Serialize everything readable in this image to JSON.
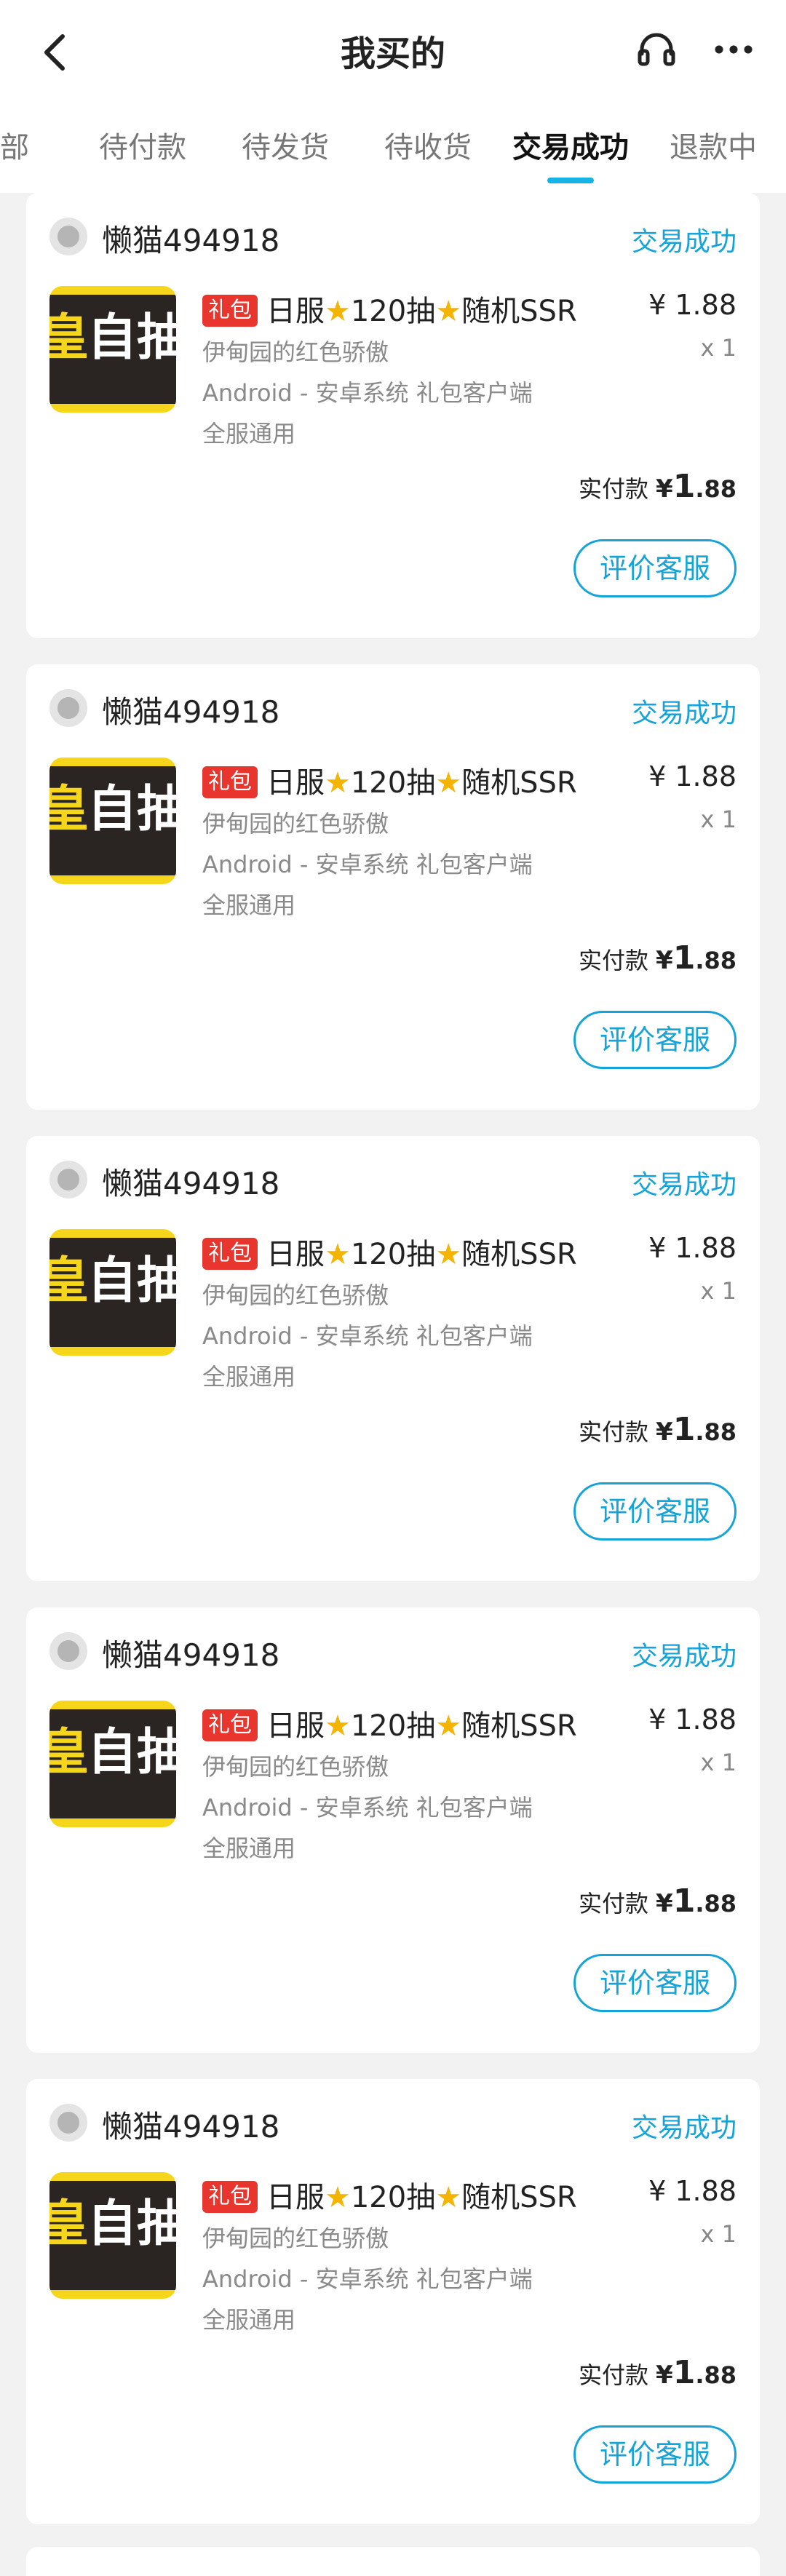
{
  "header": {
    "title": "我买的",
    "back_icon": "chevron-left-icon",
    "service_icon": "headset-icon",
    "more_icon": "more-dots-icon"
  },
  "tabs": [
    {
      "label": "部",
      "active": false
    },
    {
      "label": "待付款",
      "active": false
    },
    {
      "label": "待发货",
      "active": false
    },
    {
      "label": "待收货",
      "active": false
    },
    {
      "label": "交易成功",
      "active": true
    },
    {
      "label": "退款中",
      "active": false
    }
  ],
  "colors": {
    "accent": "#15b3e6",
    "tag_red": "#e8352e",
    "thumb_yellow": "#f6d61a",
    "thumb_dark": "#2a2523"
  },
  "orders": [
    {
      "shop": "懒猫494918",
      "status": "交易成功",
      "thumb_text_left": "皇",
      "thumb_text_right": "自抽",
      "tag": "礼包",
      "title_part1": "日服",
      "title_part2": "120抽",
      "title_part3": "随机SSR",
      "price": "¥ 1.88",
      "qty": "x 1",
      "line1": "伊甸园的红色骄傲",
      "line2": "Android - 安卓系统  礼包客户端",
      "line3": "全服通用",
      "paid_label": "实付款",
      "paid_currency": "¥",
      "paid_int": "1",
      "paid_dec": ".88",
      "button": "评价客服"
    },
    {
      "shop": "懒猫494918",
      "status": "交易成功",
      "thumb_text_left": "皇",
      "thumb_text_right": "自抽",
      "tag": "礼包",
      "title_part1": "日服",
      "title_part2": "120抽",
      "title_part3": "随机SSR",
      "price": "¥ 1.88",
      "qty": "x 1",
      "line1": "伊甸园的红色骄傲",
      "line2": "Android - 安卓系统  礼包客户端",
      "line3": "全服通用",
      "paid_label": "实付款",
      "paid_currency": "¥",
      "paid_int": "1",
      "paid_dec": ".88",
      "button": "评价客服"
    },
    {
      "shop": "懒猫494918",
      "status": "交易成功",
      "thumb_text_left": "皇",
      "thumb_text_right": "自抽",
      "tag": "礼包",
      "title_part1": "日服",
      "title_part2": "120抽",
      "title_part3": "随机SSR",
      "price": "¥ 1.88",
      "qty": "x 1",
      "line1": "伊甸园的红色骄傲",
      "line2": "Android - 安卓系统  礼包客户端",
      "line3": "全服通用",
      "paid_label": "实付款",
      "paid_currency": "¥",
      "paid_int": "1",
      "paid_dec": ".88",
      "button": "评价客服"
    },
    {
      "shop": "懒猫494918",
      "status": "交易成功",
      "thumb_text_left": "皇",
      "thumb_text_right": "自抽",
      "tag": "礼包",
      "title_part1": "日服",
      "title_part2": "120抽",
      "title_part3": "随机SSR",
      "price": "¥ 1.88",
      "qty": "x 1",
      "line1": "伊甸园的红色骄傲",
      "line2": "Android - 安卓系统  礼包客户端",
      "line3": "全服通用",
      "paid_label": "实付款",
      "paid_currency": "¥",
      "paid_int": "1",
      "paid_dec": ".88",
      "button": "评价客服"
    },
    {
      "shop": "懒猫494918",
      "status": "交易成功",
      "thumb_text_left": "皇",
      "thumb_text_right": "自抽",
      "tag": "礼包",
      "title_part1": "日服",
      "title_part2": "120抽",
      "title_part3": "随机SSR",
      "price": "¥ 1.88",
      "qty": "x 1",
      "line1": "伊甸园的红色骄傲",
      "line2": "Android - 安卓系统  礼包客户端",
      "line3": "全服通用",
      "paid_label": "实付款",
      "paid_currency": "¥",
      "paid_int": "1",
      "paid_dec": ".88",
      "button": "评价客服"
    }
  ]
}
